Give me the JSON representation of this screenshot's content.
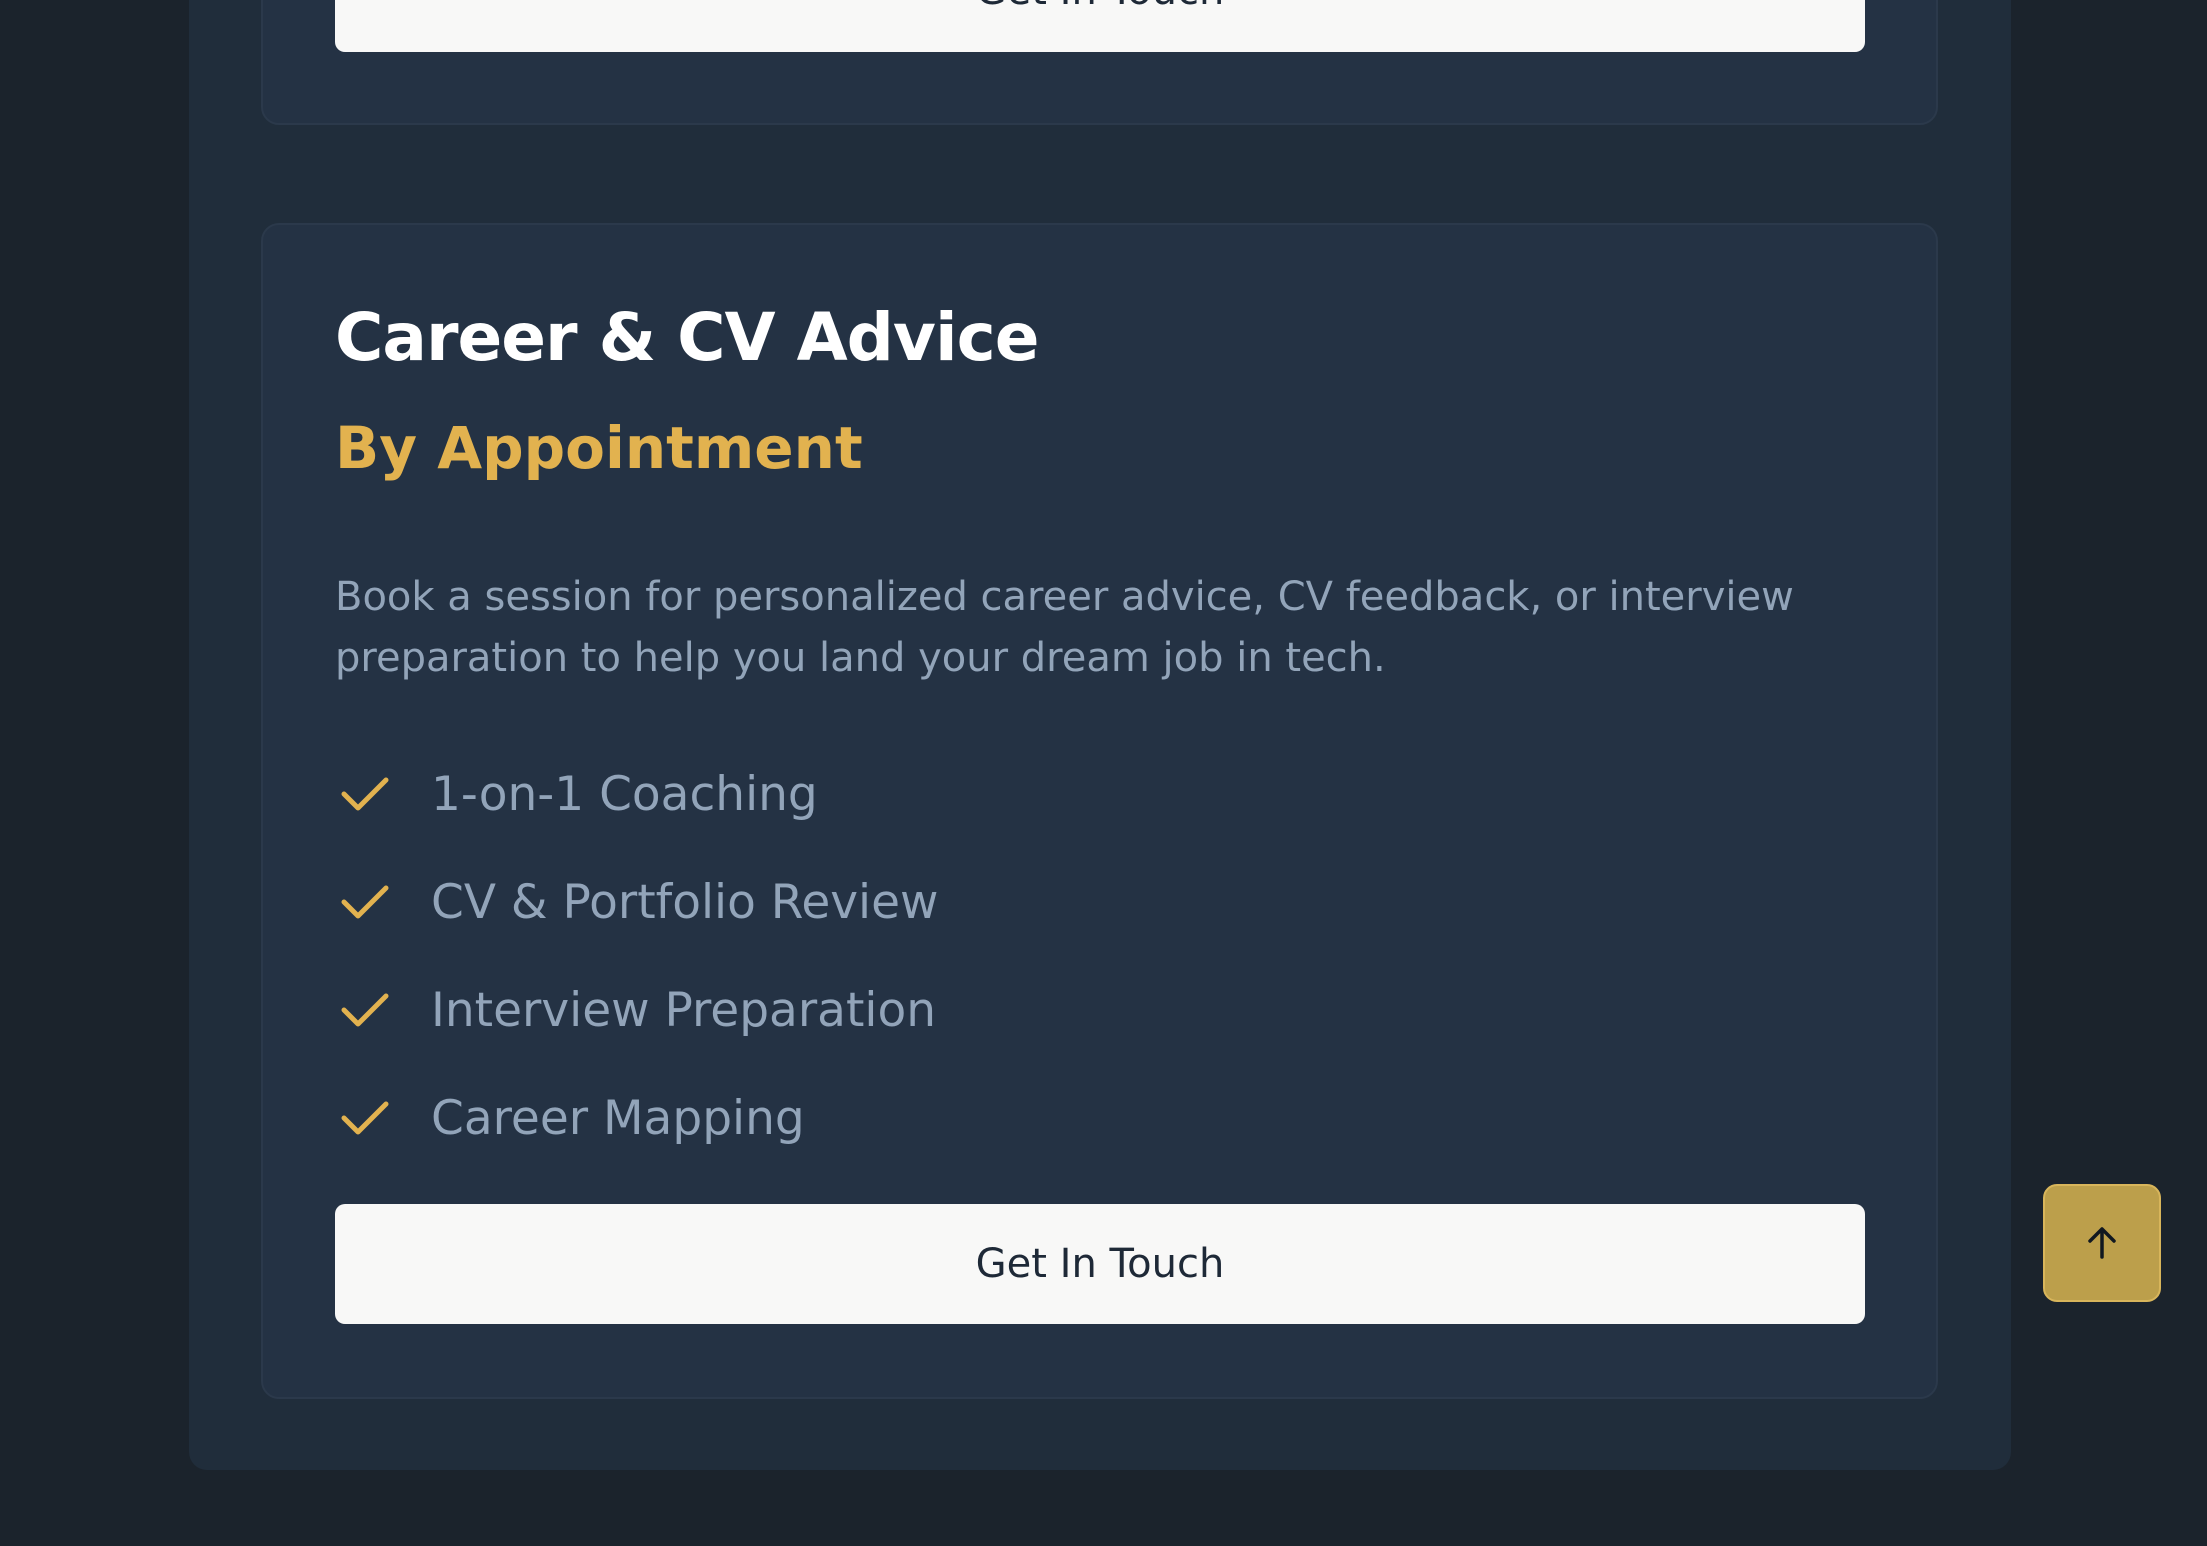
{
  "top_card": {
    "button_label": "Get In Touch"
  },
  "service": {
    "title": "Career & CV Advice",
    "availability": "By Appointment",
    "description": "Book a session for personalized career advice, CV feedback, or interview preparation to help you land your dream job in tech.",
    "features": [
      "1-on-1 Coaching",
      "CV & Portfolio Review",
      "Interview Preparation",
      "Career Mapping"
    ],
    "button_label": "Get In Touch"
  },
  "icons": {
    "feature_icon": "check-icon",
    "back_to_top": "arrow-up-icon"
  },
  "colors": {
    "background": "#1b232c",
    "panel": "#202d3b",
    "card": "#243244",
    "accent": "#e2b24f",
    "muted_text": "#92a4b9",
    "button": "#f8f8f7",
    "back_to_top": "#bc9f4b"
  }
}
